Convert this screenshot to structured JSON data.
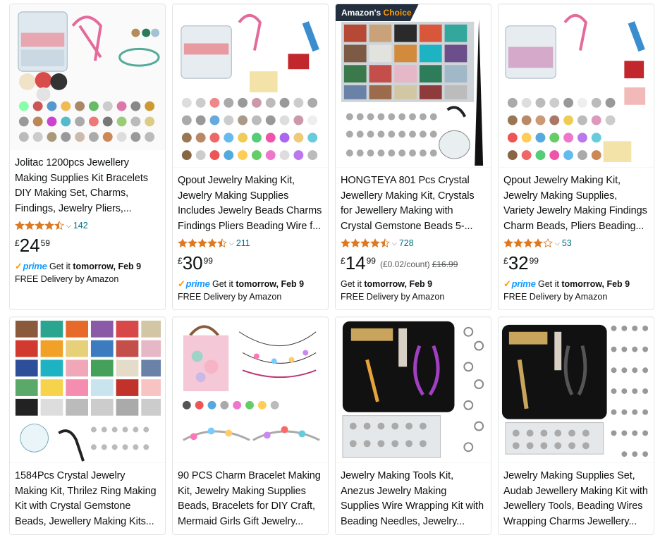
{
  "badges": {
    "choice_prefix": "Amazon's ",
    "choice_word": "Choice"
  },
  "colors": {
    "star": "#de7921",
    "link": "#007185",
    "prime_blue": "#1399ff",
    "prime_check": "#ff9900"
  },
  "products": [
    {
      "title": "Jolitac 1200pcs Jewellery Making Supplies Kit Bracelets DIY Making Set, Charms, Findings, Jewelry Pliers,...",
      "rating": 4.5,
      "review_count": "142",
      "price": {
        "currency": "£",
        "whole": "24",
        "fraction": "59"
      },
      "prime": true,
      "delivery_prefix": "Get it ",
      "delivery_date": "tomorrow, Feb 9",
      "free_delivery": "FREE Delivery by Amazon"
    },
    {
      "title": "Qpout Jewelry Making Kit, Jewelry Making Supplies Includes Jewelry Beads Charms Findings Pliers Beading Wire f...",
      "rating": 4.5,
      "review_count": "211",
      "price": {
        "currency": "£",
        "whole": "30",
        "fraction": "99"
      },
      "prime": true,
      "delivery_prefix": "Get it ",
      "delivery_date": "tomorrow, Feb 9",
      "free_delivery": "FREE Delivery by Amazon"
    },
    {
      "title": "HONGTEYA 801 Pcs Crystal Jewellery Making Kit, Crystals for Jewellery Making with Crystal Gemstone Beads 5-...",
      "rating": 4.5,
      "review_count": "728",
      "price": {
        "currency": "£",
        "whole": "14",
        "fraction": "99",
        "unit_price": "(£0.02/count)",
        "list_price": "£16.99"
      },
      "badge": true,
      "prime": false,
      "delivery_prefix": "Get it ",
      "delivery_date": "tomorrow, Feb 9",
      "free_delivery": "FREE Delivery by Amazon"
    },
    {
      "title": "Qpout Jewelry Making Kit, Jewelry Making Supplies, Variety Jewelry Making Findings Charm Beads, Pliers Beading...",
      "rating": 4.0,
      "review_count": "53",
      "price": {
        "currency": "£",
        "whole": "32",
        "fraction": "99"
      },
      "prime": true,
      "delivery_prefix": "Get it ",
      "delivery_date": "tomorrow, Feb 9",
      "free_delivery": "FREE Delivery by Amazon"
    },
    {
      "title": "1584Pcs Crystal Jewelry Making Kit, Thrilez Ring Making Kit with Crystal Gemstone Beads, Jewellery Making Kits..."
    },
    {
      "title": "90 PCS Charm Bracelet Making Kit, Jewelry Making Supplies Beads, Bracelets for DIY Craft, Mermaid Girls Gift Jewelry..."
    },
    {
      "title": "Jewelry Making Tools Kit, Anezus Jewelry Making Supplies Wire Wrapping Kit with Beading Needles, Jewelry..."
    },
    {
      "title": "Jewelry Making Supplies Set, Audab Jewellery Making Kit with Jewellery Tools, Beading Wires Wrapping Charms Jewellery..."
    }
  ],
  "prime_label": "prime"
}
